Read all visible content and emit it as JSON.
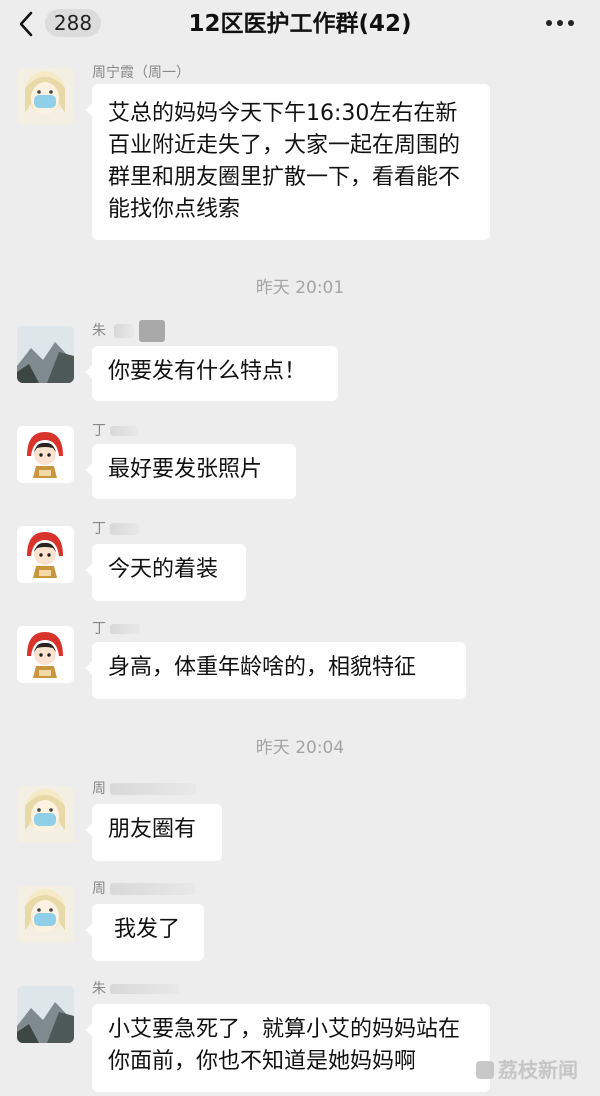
{
  "header": {
    "unread_count": "288",
    "title": "12区医护工作群(42)"
  },
  "timestamps": [
    "昨天 20:01",
    "昨天 20:04"
  ],
  "messages": [
    {
      "sender": "周宁霞（周一）",
      "text": "艾总的妈妈今天下午16:30左右在新百业附近走失了，大家一起在周围的群里和朋友圈里扩散一下，看看能不能找你点线索",
      "avatar": "masked-woman-avatar"
    },
    {
      "sender": "朱",
      "text": "你要发有什么特点！",
      "avatar": "mountain-avatar"
    },
    {
      "sender": "丁",
      "text": "最好要发张照片",
      "avatar": "cartoon-girl-avatar"
    },
    {
      "sender": "丁",
      "text": "今天的着装",
      "avatar": "cartoon-girl-avatar"
    },
    {
      "sender": "丁",
      "text": "身高，体重年龄啥的，相貌特征",
      "avatar": "cartoon-girl-avatar"
    },
    {
      "sender": "周",
      "text": "朋友圈有",
      "avatar": "masked-woman-avatar"
    },
    {
      "sender": "周",
      "text": "我发了",
      "avatar": "masked-woman-avatar"
    },
    {
      "sender": "朱",
      "text": "小艾要急死了，就算小艾的妈妈站在你面前，你也不知道是她妈妈啊",
      "avatar": "mountain-avatar"
    }
  ],
  "watermark": "荔枝新闻",
  "colors": {
    "background": "#ededed",
    "bubble": "#ffffff",
    "timestamp": "#a4a4a4",
    "sender": "#888888"
  }
}
